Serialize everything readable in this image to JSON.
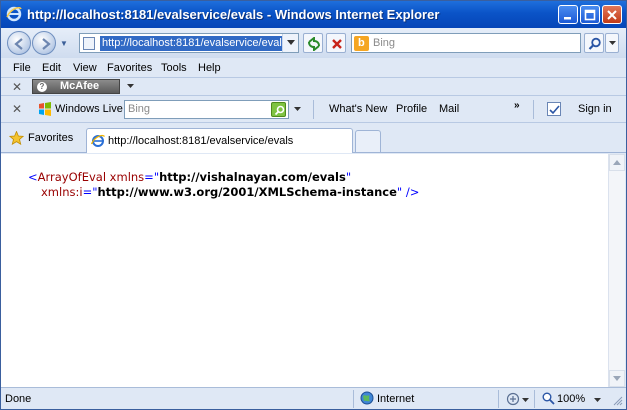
{
  "window": {
    "title": "http://localhost:8181/evalservice/evals - Windows Internet Explorer"
  },
  "address": {
    "url": "http://localhost:8181/evalservice/evals"
  },
  "search": {
    "placeholder": "Bing"
  },
  "menu": [
    "File",
    "Edit",
    "View",
    "Favorites",
    "Tools",
    "Help"
  ],
  "mcafee": {
    "label": "McAfee",
    "badge": "?"
  },
  "windows_live": {
    "label": "Windows Live",
    "search_placeholder": "Bing",
    "links": [
      "What's New",
      "Profile",
      "Mail"
    ],
    "more": "»",
    "sign_in": "Sign in"
  },
  "favorites": {
    "label": "Favorites"
  },
  "tab": {
    "label": "http://localhost:8181/evalservice/evals"
  },
  "content": {
    "line1": {
      "open": "<",
      "tag": "ArrayOfEval",
      "attr": " xmlns",
      "eq": "=",
      "q1": "\"",
      "value": "http://vishalnayan.com/evals",
      "q2": "\""
    },
    "line2": {
      "attr": "xmlns:i",
      "eq": "=",
      "q1": "\"",
      "value": "http://www.w3.org/2001/XMLSchema-instance",
      "q2": "\"",
      "close": " />"
    }
  },
  "status": {
    "text": "Done",
    "zone": "Internet",
    "zoom": "100%"
  },
  "colors": {
    "titlebar": "#0a53c7",
    "xml_tag": "#990000",
    "xml_punct": "#0000ff",
    "selection": "#316ac5"
  }
}
